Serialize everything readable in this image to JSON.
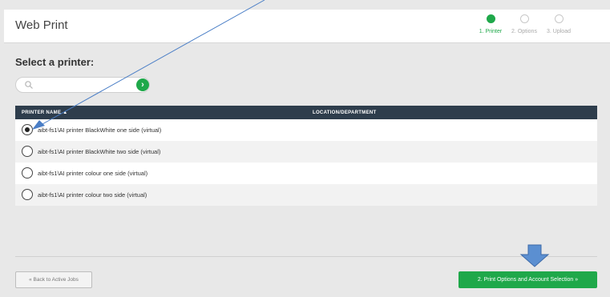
{
  "header": {
    "title": "Web Print",
    "steps": [
      {
        "label": "1. Printer",
        "state": "active"
      },
      {
        "label": "2. Options",
        "state": "inactive"
      },
      {
        "label": "3. Upload",
        "state": "inactive"
      }
    ]
  },
  "main": {
    "section_title": "Select a printer:",
    "search": {
      "placeholder": "",
      "button_glyph": "›"
    },
    "table": {
      "columns": [
        "PRINTER NAME ▲",
        "LOCATION/DEPARTMENT"
      ],
      "rows": [
        {
          "name": "aibt-fs1\\AI printer BlackWhite one side (virtual)",
          "location": "",
          "selected": true
        },
        {
          "name": "aibt-fs1\\AI printer BlackWhite two side (virtual)",
          "location": "",
          "selected": false
        },
        {
          "name": "aibt-fs1\\AI printer colour one side (virtual)",
          "location": "",
          "selected": false
        },
        {
          "name": "aibt-fs1\\AI printer colour two side (virtual)",
          "location": "",
          "selected": false
        }
      ]
    }
  },
  "footer": {
    "back_label": "« Back to Active Jobs",
    "next_label": "2. Print Options and Account Selection »"
  },
  "colors": {
    "accent": "#1fa84a",
    "table_header": "#2e3d4c",
    "annotation": "#4a7ec6"
  },
  "icons": {
    "search": "search-icon",
    "go": "chevron-right-icon",
    "annotation_arrow": "down-arrow-icon"
  }
}
